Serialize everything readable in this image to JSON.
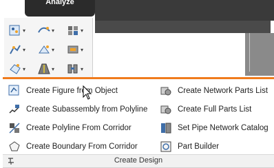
{
  "ribbon": {
    "tab_label": "Analyze",
    "panel_title": "Create Design"
  },
  "tools": {
    "row1": [
      "points-icon",
      "alignment-icon",
      "feature-line-icon"
    ],
    "row2": [
      "profile-icon",
      "surface-icon",
      "grading-icon"
    ],
    "row3": [
      "parcel-icon",
      "corridor-icon",
      "pipe-network-icon"
    ]
  },
  "menu": {
    "left": [
      {
        "label": "Create Figure from Object",
        "icon": "figure-from-object-icon"
      },
      {
        "label": "Create Subassembly from Polyline",
        "icon": "subassembly-icon"
      },
      {
        "label": "Create Polyline From Corridor",
        "icon": "polyline-corridor-icon"
      },
      {
        "label": "Create Boundary From Corridor",
        "icon": "boundary-icon"
      }
    ],
    "right": [
      {
        "label": "Create Network Parts List",
        "icon": "network-parts-list-icon"
      },
      {
        "label": "Create Full Parts List",
        "icon": "full-parts-list-icon"
      },
      {
        "label": "Set Pipe Network Catalog",
        "icon": "pipe-catalog-icon"
      },
      {
        "label": "Part Builder",
        "icon": "part-builder-icon"
      }
    ]
  },
  "colors": {
    "accent": "#f07b1c",
    "dark": "#2b2b2b"
  }
}
